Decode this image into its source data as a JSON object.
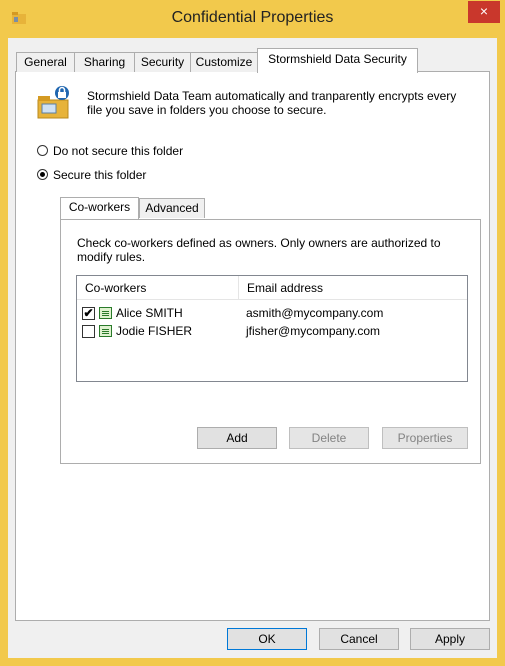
{
  "window": {
    "title": "Confidential Properties",
    "close_glyph": "×"
  },
  "tabs": [
    {
      "label": "General"
    },
    {
      "label": "Sharing"
    },
    {
      "label": "Security"
    },
    {
      "label": "Customize"
    },
    {
      "label": "Stormshield Data Security"
    }
  ],
  "active_tab": "Stormshield Data Security",
  "description": "Stormshield Data Team automatically and tranparently encrypts every file you save in folders you choose to secure.",
  "radios": [
    {
      "label": "Do not secure this folder",
      "selected": false
    },
    {
      "label": "Secure this folder",
      "selected": true
    }
  ],
  "inner_tabs": [
    {
      "label": "Co-workers"
    },
    {
      "label": "Advanced"
    }
  ],
  "coworkers": {
    "instruction": "Check co-workers defined as owners. Only owners are authorized to modify rules.",
    "columns": [
      "Co-workers",
      "Email address"
    ],
    "rows": [
      {
        "name": "Alice SMITH",
        "email": "asmith@mycompany.com",
        "checked": true
      },
      {
        "name": "Jodie FISHER",
        "email": "jfisher@mycompany.com",
        "checked": false
      }
    ],
    "buttons": {
      "add": "Add",
      "delete": "Delete",
      "properties": "Properties"
    }
  },
  "footer": {
    "ok": "OK",
    "cancel": "Cancel",
    "apply": "Apply"
  },
  "check_glyph": "✔"
}
